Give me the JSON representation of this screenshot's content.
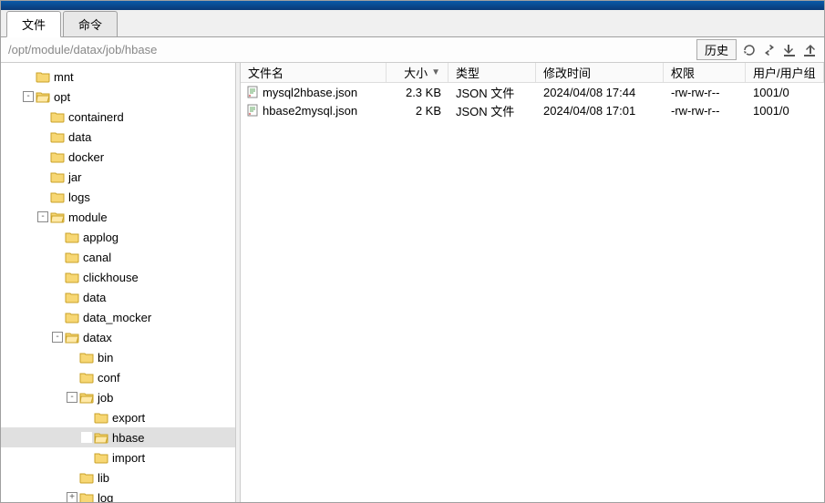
{
  "tabs": {
    "file": "文件",
    "cmd": "命令"
  },
  "path": "/opt/module/datax/job/hbase",
  "history_label": "历史",
  "file_header": {
    "name": "文件名",
    "size": "大小",
    "type": "类型",
    "mtime": "修改时间",
    "perm": "权限",
    "user": "用户/用户组"
  },
  "files": [
    {
      "name": "mysql2hbase.json",
      "size": "2.3 KB",
      "type": "JSON 文件",
      "mtime": "2024/04/08 17:44",
      "perm": "-rw-rw-r--",
      "user": "1001/0"
    },
    {
      "name": "hbase2mysql.json",
      "size": "2 KB",
      "type": "JSON 文件",
      "mtime": "2024/04/08 17:01",
      "perm": "-rw-rw-r--",
      "user": "1001/0"
    }
  ],
  "tree": [
    {
      "depth": 1,
      "exp": "",
      "open": false,
      "label": "mnt"
    },
    {
      "depth": 1,
      "exp": "-",
      "open": true,
      "label": "opt"
    },
    {
      "depth": 2,
      "exp": "",
      "open": false,
      "label": "containerd"
    },
    {
      "depth": 2,
      "exp": "",
      "open": false,
      "label": "data"
    },
    {
      "depth": 2,
      "exp": "",
      "open": false,
      "label": "docker"
    },
    {
      "depth": 2,
      "exp": "",
      "open": false,
      "label": "jar"
    },
    {
      "depth": 2,
      "exp": "",
      "open": false,
      "label": "logs"
    },
    {
      "depth": 2,
      "exp": "-",
      "open": true,
      "label": "module"
    },
    {
      "depth": 3,
      "exp": "",
      "open": false,
      "label": "applog"
    },
    {
      "depth": 3,
      "exp": "",
      "open": false,
      "label": "canal"
    },
    {
      "depth": 3,
      "exp": "",
      "open": false,
      "label": "clickhouse"
    },
    {
      "depth": 3,
      "exp": "",
      "open": false,
      "label": "data"
    },
    {
      "depth": 3,
      "exp": "",
      "open": false,
      "label": "data_mocker"
    },
    {
      "depth": 3,
      "exp": "-",
      "open": true,
      "label": "datax"
    },
    {
      "depth": 4,
      "exp": "",
      "open": false,
      "label": "bin"
    },
    {
      "depth": 4,
      "exp": "",
      "open": false,
      "label": "conf"
    },
    {
      "depth": 4,
      "exp": "-",
      "open": true,
      "label": "job"
    },
    {
      "depth": 5,
      "exp": "",
      "open": false,
      "label": "export"
    },
    {
      "depth": 5,
      "exp": "",
      "open": true,
      "label": "hbase",
      "selected": true
    },
    {
      "depth": 5,
      "exp": "",
      "open": false,
      "label": "import"
    },
    {
      "depth": 4,
      "exp": "",
      "open": false,
      "label": "lib"
    },
    {
      "depth": 4,
      "exp": "+",
      "open": false,
      "label": "log"
    }
  ]
}
